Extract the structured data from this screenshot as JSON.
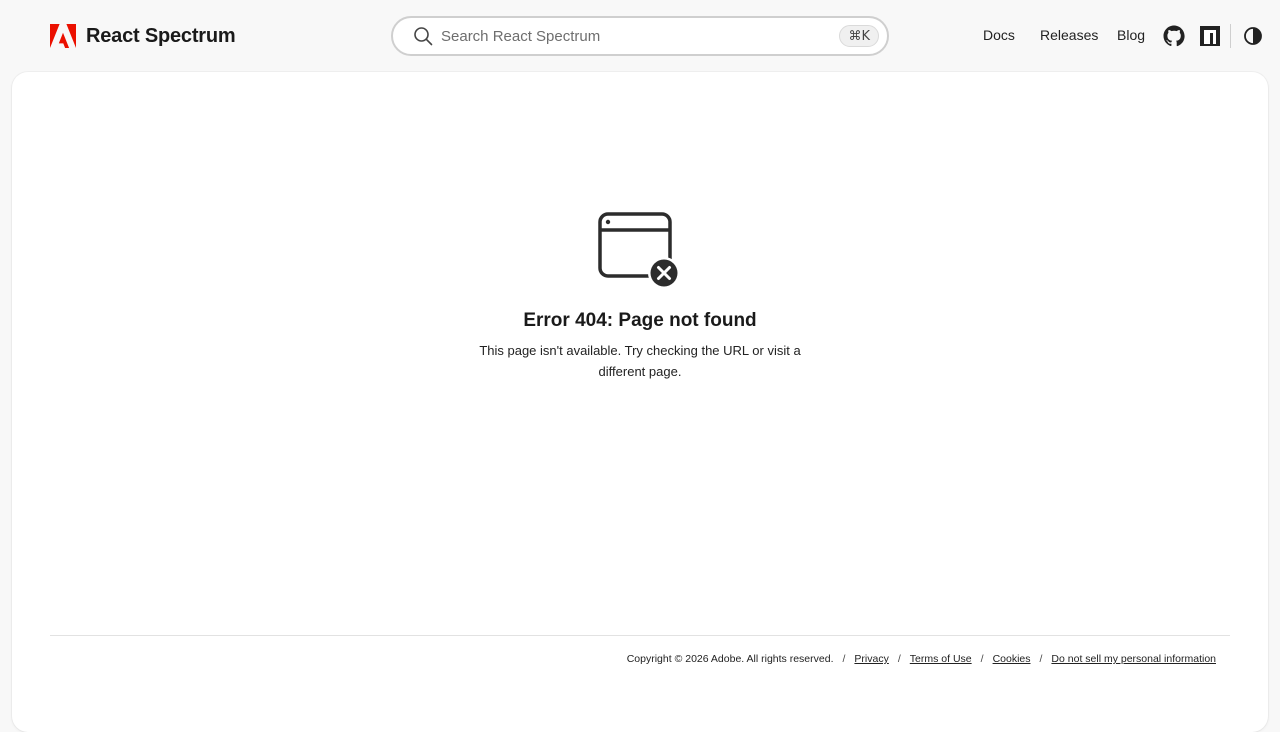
{
  "brand": {
    "name": "React Spectrum",
    "logo_icon": "adobe-logo-icon",
    "logo_color": "#eb1000"
  },
  "search": {
    "placeholder": "Search React Spectrum",
    "value": "",
    "shortcut": "⌘K",
    "icon": "search-icon"
  },
  "nav": {
    "links": [
      {
        "label": "Docs"
      },
      {
        "label": "Releases"
      },
      {
        "label": "Blog"
      }
    ],
    "icons": [
      "github-icon",
      "npm-icon",
      "theme-toggle-icon"
    ]
  },
  "error": {
    "icon": "browser-window-error-icon",
    "title": "Error 404: Page not found",
    "message": "This page isn't available. Try checking the URL or visit a different page."
  },
  "footer": {
    "copyright": "Copyright © 2026 Adobe. All rights reserved.",
    "separator": "/",
    "links": [
      {
        "label": "Privacy"
      },
      {
        "label": "Terms of Use"
      },
      {
        "label": "Cookies"
      },
      {
        "label": "Do not sell my personal information"
      }
    ]
  }
}
